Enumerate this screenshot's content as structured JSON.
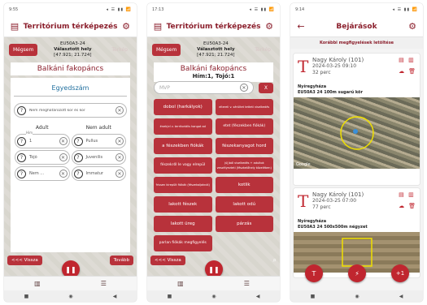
{
  "status": {
    "time1": "9:55",
    "time2": "17:13",
    "time3": "9:14",
    "icons": "◂ ☰ ▮▮ 📶"
  },
  "screen1": {
    "title": "Territórium térképezés",
    "cancel": "Mégsem",
    "location_code": "EU50A3-24",
    "selected_place": "Választott hely",
    "coords": "[47.921; 21.724]",
    "ghost_btn": "Térkép",
    "species": "Balkáni fakopáncs",
    "panel_title": "Egyedszám",
    "age_unknown": "Nem meghatározott kor és kor",
    "col_adult": "Adult",
    "col_nonadult": "Nem adult",
    "adult_rows": [
      {
        "label": "Him",
        "value": "1"
      },
      {
        "label": "",
        "value": "Tojó"
      },
      {
        "label": "",
        "value": "Nem ..."
      }
    ],
    "nonadult_rows": [
      {
        "value": "Pullus"
      },
      {
        "value": "Juvenilis"
      },
      {
        "value": "Immatur"
      }
    ],
    "back": "<<< Vissza",
    "next": "Tovább"
  },
  "screen2": {
    "title": "Territórium térképezés",
    "cancel": "Mégsem",
    "location_code": "EU50A3-24",
    "selected_place": "Választott hely",
    "coords": "[47.921; 21.724]",
    "ghost_btn": "Térkép",
    "species": "Balkáni fakopáncs",
    "species_sub": "Hím:1, Tojó:1",
    "search_placeholder": "MVP",
    "clear": "X",
    "buttons": [
      "dobol (harkályok)",
      "eltereli v. sérültet tetteti viselkedés",
      "ének(el v. territoriális hangot ad",
      "etet (fészekben fiókák)",
      "a fészekben fiókák",
      "fészekanyagot hord",
      "fészekről le vagy elrepül",
      "(új)ból viselkedés + adultok veszélyezteti (fészkelőhely közelében)",
      "frissen kirepült fiókák (fészekaljaknál)",
      "kotlik",
      "lakott fészek",
      "lakott odú",
      "lakott üreg",
      "párzás",
      "parlan fiókák megfigyelés",
      ""
    ],
    "back": "<<< Vissza"
  },
  "screen3": {
    "title": "Bejárások",
    "download": "Korábbi megfigyelések letöltése",
    "cards": [
      {
        "letter": "T",
        "name": "Nagy Károly (101)",
        "date": "2024-03-25 09:10",
        "duration": "32 perc",
        "place": "Nyíregyháza",
        "desc": "EU50A3 24 100m sugarú kör",
        "map_credit": "Google"
      },
      {
        "letter": "T",
        "name": "Nagy Károly (101)",
        "date": "2024-03-25 07:00",
        "duration": "77 perc",
        "place": "Nyíregyháza",
        "desc": "EU50A3 24 500x500m négyzet",
        "map_credit": ""
      }
    ],
    "fab_left": "T",
    "fab_right": "+1"
  },
  "colors": {
    "accent": "#b8323b",
    "title": "#8b1f2c",
    "blue_title": "#1f6e9e"
  }
}
